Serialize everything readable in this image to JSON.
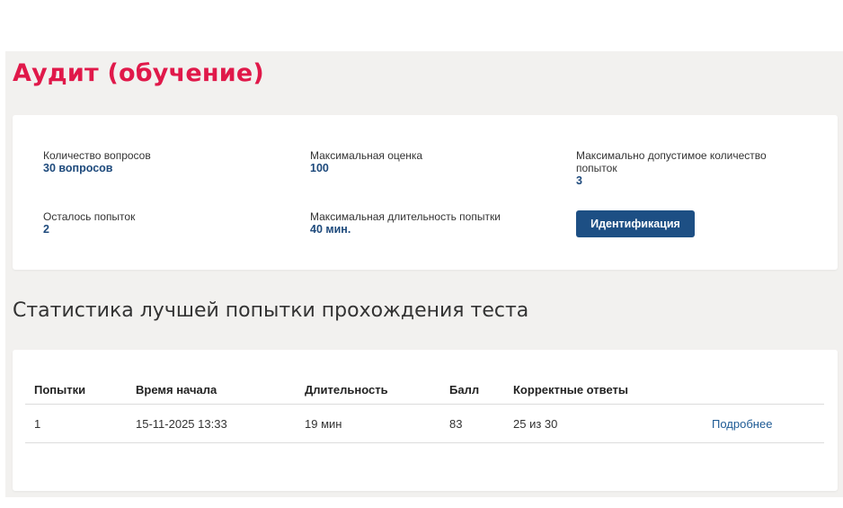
{
  "page": {
    "title": "Аудит (обучение)"
  },
  "info": {
    "questions_label": "Количество вопросов",
    "questions_value": "30 вопросов",
    "max_score_label": "Максимальная оценка",
    "max_score_value": "100",
    "max_attempts_label_line1": "Максимально допустимое количество",
    "max_attempts_label_line2": "попыток",
    "max_attempts_value": "3",
    "remaining_label": "Осталось попыток",
    "remaining_value": "2",
    "max_duration_label": "Максимальная длительность попытки",
    "max_duration_value": "40 мин.",
    "ident_button": "Идентификация"
  },
  "stats": {
    "title": "Статистика лучшей попытки прохождения теста",
    "columns": [
      "Попытки",
      "Время начала",
      "Длительность",
      "Балл",
      "Корректные ответы"
    ],
    "rows": [
      {
        "attempt": "1",
        "start": "15-11-2025 13:33",
        "duration": "19 мин",
        "score": "83",
        "correct": "25 из 30",
        "link": "Подробнее"
      }
    ]
  },
  "colors": {
    "accent": "#e0194a",
    "primary": "#1d4f84",
    "value": "#1e4a7c",
    "background": "#f2f1ef"
  }
}
